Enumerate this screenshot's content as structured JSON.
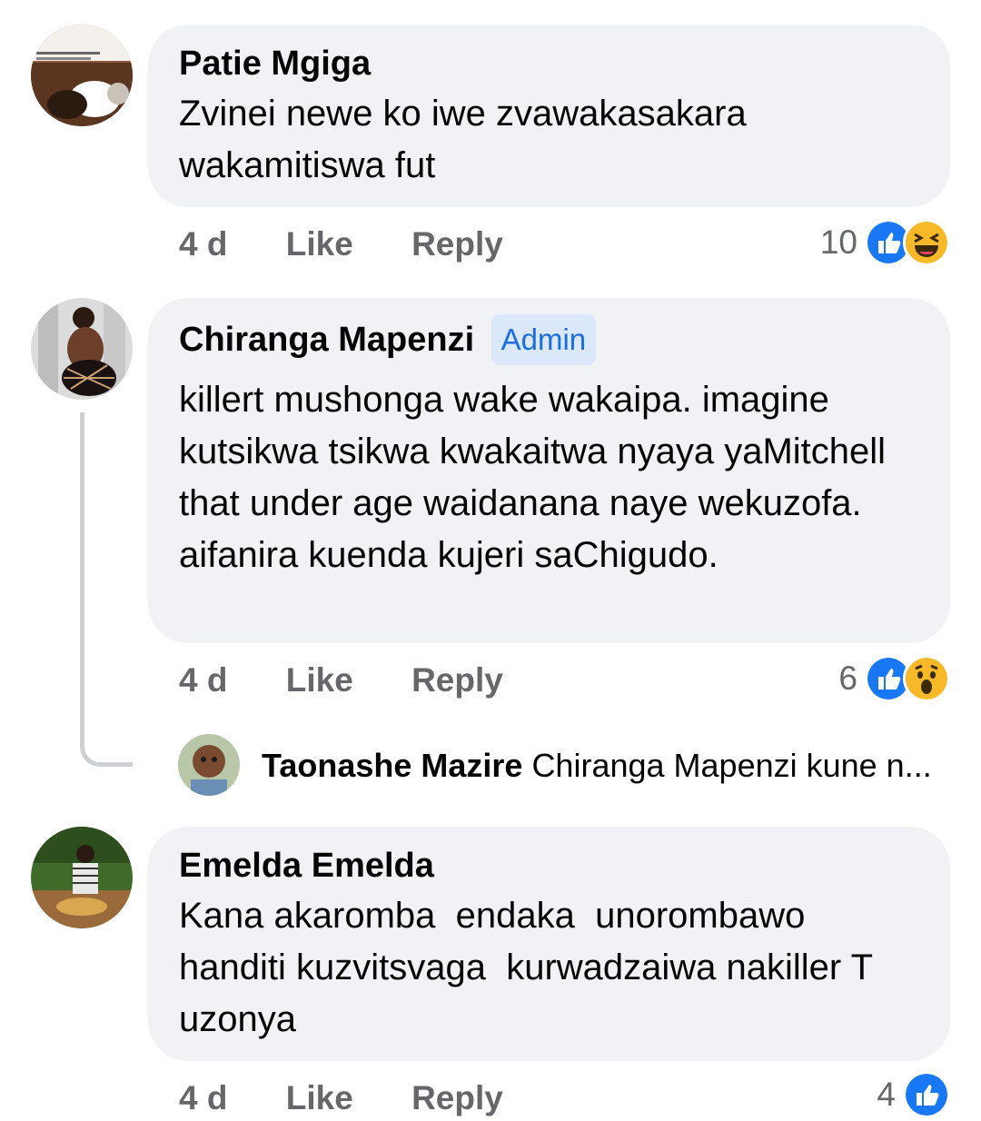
{
  "comments": [
    {
      "author": "Patie Mgiga",
      "badge": "",
      "text": "Zvinei newe ko iwe zvawakasakara wakamitiswa fut",
      "time": "4 d",
      "like_label": "Like",
      "reply_label": "Reply",
      "reaction_count": "10",
      "reactions": [
        "like-icon",
        "laugh-icon"
      ]
    },
    {
      "author": "Chiranga Mapenzi",
      "badge": "Admin",
      "text": "killert mushonga wake wakaipa. imagine kutsikwa tsikwa kwakaitwa nyaya yaMitchell that under age waidanana naye wekuzofa. aifanira kuenda kujeri saChigudo.",
      "time": "4 d",
      "like_label": "Like",
      "reply_label": "Reply",
      "reaction_count": "6",
      "reactions": [
        "like-icon",
        "wow-icon"
      ]
    },
    {
      "author": "Emelda Emelda",
      "badge": "",
      "text": "Kana akaromba  endaka  unorombawo handiti kuzvitsvaga  kurwadzaiwa nakiller T uzonya",
      "time": "4 d",
      "like_label": "Like",
      "reply_label": "Reply",
      "reaction_count": "4",
      "reactions": [
        "like-icon"
      ]
    }
  ],
  "reply_preview": {
    "author": "Taonashe Mazire",
    "text": "Chiranga Mapenzi kune n..."
  },
  "colors": {
    "bubble": "#f0f2f5",
    "meta_text": "#65676b",
    "admin_badge_bg": "#dbe7fb",
    "admin_badge_text": "#1b6fdc",
    "like_blue": "#1877f2",
    "emoji_yellow": "#f7b928"
  }
}
